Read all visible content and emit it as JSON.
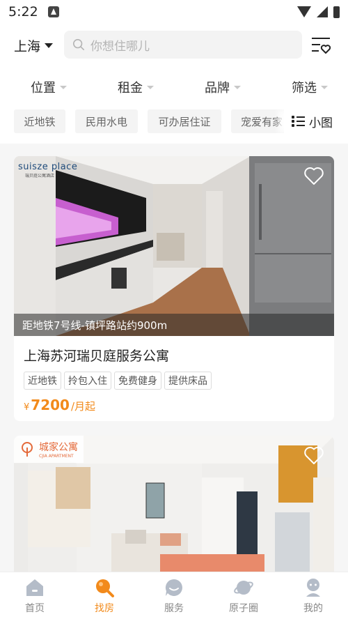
{
  "status": {
    "time": "5:22"
  },
  "header": {
    "city": "上海",
    "search_placeholder": "你想住哪儿"
  },
  "filters": [
    "位置",
    "租金",
    "品牌",
    "筛选"
  ],
  "quick_tags": [
    "近地铁",
    "民用水电",
    "可办居住证",
    "宠爱有家"
  ],
  "view_toggle": "小图",
  "listings": [
    {
      "brand": "suisze place",
      "brand_sub": "瑞贝庭公寓酒店",
      "caption": "距地铁7号线-镇坪路站约900m",
      "title": "上海苏河瑞贝庭服务公寓",
      "tags": [
        "近地铁",
        "拎包入住",
        "免费健身",
        "提供床品"
      ],
      "price_symbol": "¥",
      "price": "7200",
      "price_unit": "/月起"
    },
    {
      "brand": "城家公寓",
      "brand_sub": "CJIA APARTMENT"
    }
  ],
  "tabbar": [
    "首页",
    "找房",
    "服务",
    "原子圈",
    "我的"
  ],
  "colors": {
    "accent": "#f28a1b",
    "gray": "#b4bcc8"
  }
}
